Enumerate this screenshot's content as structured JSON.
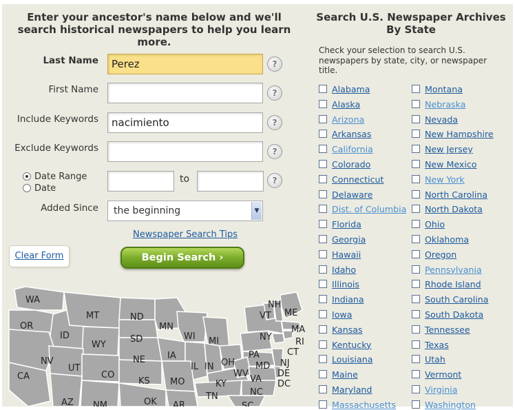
{
  "form": {
    "heading": "Enter your ancestor's name below and we'll search historical newspapers to help you learn more.",
    "last_name_label": "Last Name",
    "last_name_value": "Perez",
    "first_name_label": "First Name",
    "first_name_value": "",
    "include_label": "Include Keywords",
    "include_value": "nacimiento",
    "exclude_label": "Exclude Keywords",
    "exclude_value": "",
    "date_range_label": "Date Range",
    "date_label": "Date",
    "to_label": "to",
    "added_since_label": "Added Since",
    "added_since_value": "the beginning",
    "tips_link": "Newspaper Search Tips",
    "clear_button": "Clear Form",
    "search_button": "Begin Search ›",
    "help_glyph": "?"
  },
  "map_states": [
    "WA",
    "OR",
    "MT",
    "ND",
    "MN",
    "ID",
    "WY",
    "SD",
    "WI",
    "MI",
    "NE",
    "IA",
    "NV",
    "UT",
    "CO",
    "IL",
    "IN",
    "OH",
    "PA",
    "NY",
    "VT",
    "NH",
    "ME",
    "MA",
    "RI",
    "CT",
    "NJ",
    "MD",
    "DE",
    "DC",
    "CA",
    "KS",
    "MO",
    "KY",
    "WV",
    "VA",
    "AZ",
    "NM",
    "OK",
    "AR",
    "TN",
    "NC",
    "SC"
  ],
  "archive": {
    "heading": "Search U.S. Newspaper Archives By State",
    "instructions": "Check your selection to search U.S. newspapers by state, city, or newspaper title.",
    "col1": [
      "Alabama",
      "Alaska",
      "Arizona",
      "Arkansas",
      "California",
      "Colorado",
      "Connecticut",
      "Delaware",
      "Dist. of Columbia",
      "Florida",
      "Georgia",
      "Hawaii",
      "Idaho",
      "Illinois",
      "Indiana",
      "Iowa",
      "Kansas",
      "Kentucky",
      "Louisiana",
      "Maine",
      "Maryland",
      "Massachusetts"
    ],
    "col2": [
      "Montana",
      "Nebraska",
      "Nevada",
      "New Hampshire",
      "New Jersey",
      "New Mexico",
      "New York",
      "North Carolina",
      "North Dakota",
      "Ohio",
      "Oklahoma",
      "Oregon",
      "Pennsylvania",
      "Rhode Island",
      "South Carolina",
      "South Dakota",
      "Tennessee",
      "Texas",
      "Utah",
      "Vermont",
      "Virginia",
      "Washington"
    ],
    "link_color": "#1c5a9e",
    "visited_color": "#4a8fd0"
  }
}
